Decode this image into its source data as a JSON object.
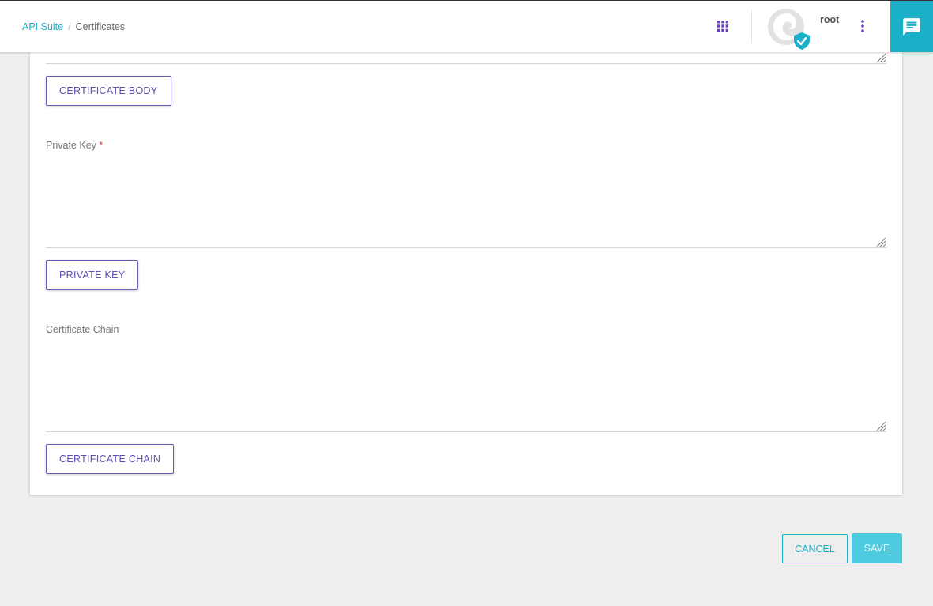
{
  "breadcrumb": {
    "root": "API Suite",
    "separator": "/",
    "current": "Certificates"
  },
  "header": {
    "username": "root",
    "icons": {
      "apps": "apps-grid-icon",
      "avatar": "avatar-with-verified-badge",
      "menu": "kebab-menu-icon",
      "chat": "chat-icon"
    }
  },
  "form": {
    "certificate_body": {
      "button_label": "CERTIFICATE BODY",
      "value": ""
    },
    "private_key": {
      "label": "Private Key",
      "required_mark": "*",
      "value": "",
      "button_label": "PRIVATE KEY"
    },
    "certificate_chain": {
      "label": "Certificate Chain",
      "value": "",
      "button_label": "CERTIFICATE CHAIN"
    }
  },
  "actions": {
    "cancel_label": "CANCEL",
    "save_label": "SAVE"
  },
  "colors": {
    "accent": "#1ab0c9",
    "save_button": "#4fcbdf",
    "upload_button_border": "#6a5bb3",
    "required": "#e53935",
    "page_background": "#eeeeee"
  }
}
